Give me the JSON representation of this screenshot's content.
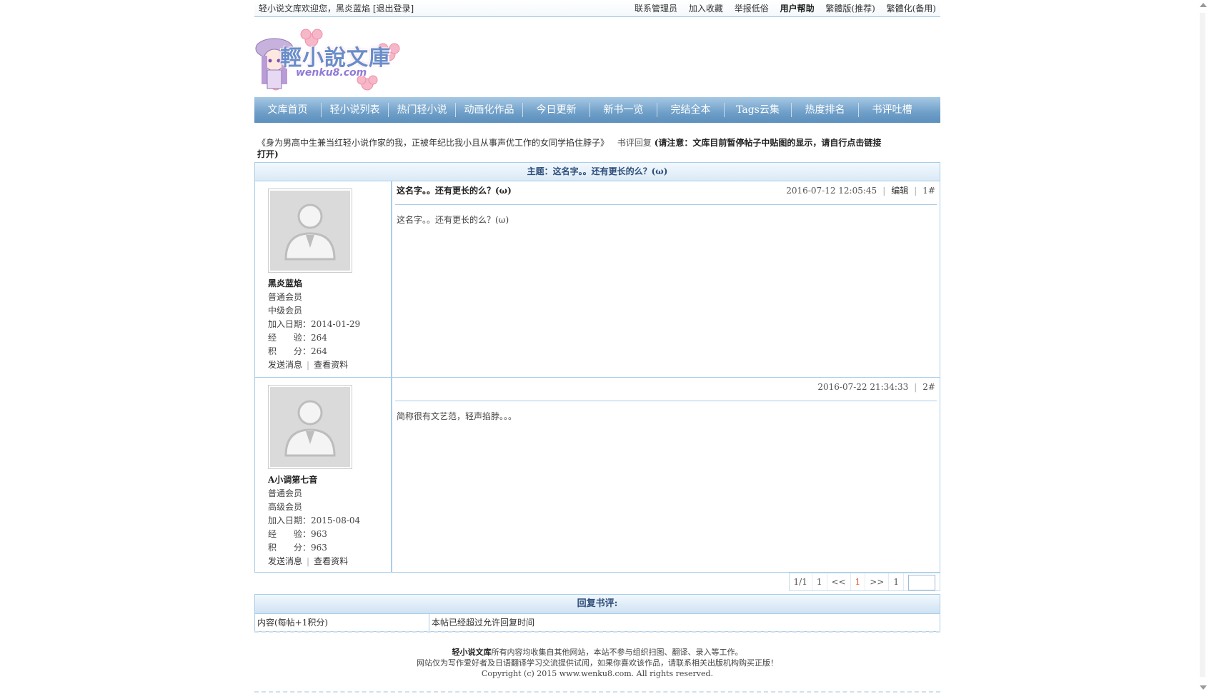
{
  "topbar": {
    "welcome": "轻小说文库欢迎您，黑炎蓝焰 [退出登录]",
    "links": [
      "联系管理员",
      "加入收藏",
      "举报低俗",
      "用户帮助",
      "繁體版(推荐)",
      "繁體化(备用)"
    ]
  },
  "logo": {
    "title": "輕小說文庫",
    "subtitle": "wenku8.com"
  },
  "nav": [
    "文库首页",
    "轻小说列表",
    "热门轻小说",
    "动画化作品",
    "今日更新",
    "新书一览",
    "完结全本",
    "Tags云集",
    "热度排名",
    "书评吐槽"
  ],
  "notice": {
    "book": "《身为男高中生兼当红轻小说作家的我，正被年纪比我小且从事声优工作的女同学掐住脖子》",
    "section": "书评回复",
    "warning": "(请注意：文库目前暂停帖子中贴图的显示，请自行点击链接打开)"
  },
  "topic": "主题：这名字。。还有更长的么？(ω)",
  "posts": [
    {
      "user": "黑炎蓝焰",
      "rank1": "普通会员",
      "rank2": "中级会员",
      "join": "加入日期：2014-01-29",
      "exp": "经　　验：264",
      "score": "积　　分：264",
      "title": "这名字。。还有更长的么？(ω)",
      "time": "2016-07-12 12:05:45",
      "edit": "编辑",
      "floor": "1#",
      "content": "这名字。。还有更长的么？(ω)"
    },
    {
      "user": "A小调第七音",
      "rank1": "普通会员",
      "rank2": "高级会员",
      "join": "加入日期：2015-08-04",
      "exp": "经　　验：963",
      "score": "积　　分：963",
      "title": "",
      "time": "2016-07-22 21:34:33",
      "floor": "2#",
      "content": "简称很有文艺范，轻声掐脖。。。"
    }
  ],
  "user_actions": {
    "message": "发送消息",
    "profile": "查看资料"
  },
  "pager": {
    "info": "1/1",
    "first": "1",
    "prev": "<<",
    "current": "1",
    "next": ">>",
    "last": "1"
  },
  "reply": {
    "heading": "回复书评:",
    "label": "内容(每帖+1积分)",
    "status": "本帖已经超过允许回复时间"
  },
  "footer": {
    "site": "轻小说文库",
    "line1": "所有内容均收集自其他网站，本站不参与组织扫图、翻译、录入等工作。",
    "line2": "网站仅为写作爱好者及日语翻译学习交流提供试阅，如果你喜欢该作品，请联系相关出版机构购买正版！",
    "line3": "Copyright (c) 2015 www.wenku8.com. All rights reserved."
  }
}
